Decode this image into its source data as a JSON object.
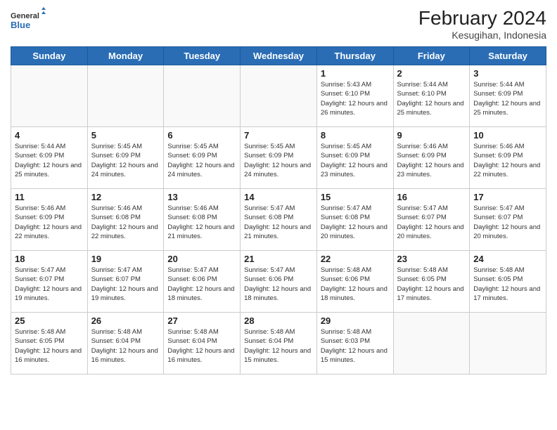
{
  "logo": {
    "general": "General",
    "blue": "Blue"
  },
  "title": "February 2024",
  "location": "Kesugihan, Indonesia",
  "days_of_week": [
    "Sunday",
    "Monday",
    "Tuesday",
    "Wednesday",
    "Thursday",
    "Friday",
    "Saturday"
  ],
  "weeks": [
    [
      {
        "day": "",
        "info": ""
      },
      {
        "day": "",
        "info": ""
      },
      {
        "day": "",
        "info": ""
      },
      {
        "day": "",
        "info": ""
      },
      {
        "day": "1",
        "info": "Sunrise: 5:43 AM\nSunset: 6:10 PM\nDaylight: 12 hours and 26 minutes."
      },
      {
        "day": "2",
        "info": "Sunrise: 5:44 AM\nSunset: 6:10 PM\nDaylight: 12 hours and 25 minutes."
      },
      {
        "day": "3",
        "info": "Sunrise: 5:44 AM\nSunset: 6:09 PM\nDaylight: 12 hours and 25 minutes."
      }
    ],
    [
      {
        "day": "4",
        "info": "Sunrise: 5:44 AM\nSunset: 6:09 PM\nDaylight: 12 hours and 25 minutes."
      },
      {
        "day": "5",
        "info": "Sunrise: 5:45 AM\nSunset: 6:09 PM\nDaylight: 12 hours and 24 minutes."
      },
      {
        "day": "6",
        "info": "Sunrise: 5:45 AM\nSunset: 6:09 PM\nDaylight: 12 hours and 24 minutes."
      },
      {
        "day": "7",
        "info": "Sunrise: 5:45 AM\nSunset: 6:09 PM\nDaylight: 12 hours and 24 minutes."
      },
      {
        "day": "8",
        "info": "Sunrise: 5:45 AM\nSunset: 6:09 PM\nDaylight: 12 hours and 23 minutes."
      },
      {
        "day": "9",
        "info": "Sunrise: 5:46 AM\nSunset: 6:09 PM\nDaylight: 12 hours and 23 minutes."
      },
      {
        "day": "10",
        "info": "Sunrise: 5:46 AM\nSunset: 6:09 PM\nDaylight: 12 hours and 22 minutes."
      }
    ],
    [
      {
        "day": "11",
        "info": "Sunrise: 5:46 AM\nSunset: 6:09 PM\nDaylight: 12 hours and 22 minutes."
      },
      {
        "day": "12",
        "info": "Sunrise: 5:46 AM\nSunset: 6:08 PM\nDaylight: 12 hours and 22 minutes."
      },
      {
        "day": "13",
        "info": "Sunrise: 5:46 AM\nSunset: 6:08 PM\nDaylight: 12 hours and 21 minutes."
      },
      {
        "day": "14",
        "info": "Sunrise: 5:47 AM\nSunset: 6:08 PM\nDaylight: 12 hours and 21 minutes."
      },
      {
        "day": "15",
        "info": "Sunrise: 5:47 AM\nSunset: 6:08 PM\nDaylight: 12 hours and 20 minutes."
      },
      {
        "day": "16",
        "info": "Sunrise: 5:47 AM\nSunset: 6:07 PM\nDaylight: 12 hours and 20 minutes."
      },
      {
        "day": "17",
        "info": "Sunrise: 5:47 AM\nSunset: 6:07 PM\nDaylight: 12 hours and 20 minutes."
      }
    ],
    [
      {
        "day": "18",
        "info": "Sunrise: 5:47 AM\nSunset: 6:07 PM\nDaylight: 12 hours and 19 minutes."
      },
      {
        "day": "19",
        "info": "Sunrise: 5:47 AM\nSunset: 6:07 PM\nDaylight: 12 hours and 19 minutes."
      },
      {
        "day": "20",
        "info": "Sunrise: 5:47 AM\nSunset: 6:06 PM\nDaylight: 12 hours and 18 minutes."
      },
      {
        "day": "21",
        "info": "Sunrise: 5:47 AM\nSunset: 6:06 PM\nDaylight: 12 hours and 18 minutes."
      },
      {
        "day": "22",
        "info": "Sunrise: 5:48 AM\nSunset: 6:06 PM\nDaylight: 12 hours and 18 minutes."
      },
      {
        "day": "23",
        "info": "Sunrise: 5:48 AM\nSunset: 6:05 PM\nDaylight: 12 hours and 17 minutes."
      },
      {
        "day": "24",
        "info": "Sunrise: 5:48 AM\nSunset: 6:05 PM\nDaylight: 12 hours and 17 minutes."
      }
    ],
    [
      {
        "day": "25",
        "info": "Sunrise: 5:48 AM\nSunset: 6:05 PM\nDaylight: 12 hours and 16 minutes."
      },
      {
        "day": "26",
        "info": "Sunrise: 5:48 AM\nSunset: 6:04 PM\nDaylight: 12 hours and 16 minutes."
      },
      {
        "day": "27",
        "info": "Sunrise: 5:48 AM\nSunset: 6:04 PM\nDaylight: 12 hours and 16 minutes."
      },
      {
        "day": "28",
        "info": "Sunrise: 5:48 AM\nSunset: 6:04 PM\nDaylight: 12 hours and 15 minutes."
      },
      {
        "day": "29",
        "info": "Sunrise: 5:48 AM\nSunset: 6:03 PM\nDaylight: 12 hours and 15 minutes."
      },
      {
        "day": "",
        "info": ""
      },
      {
        "day": "",
        "info": ""
      }
    ]
  ]
}
